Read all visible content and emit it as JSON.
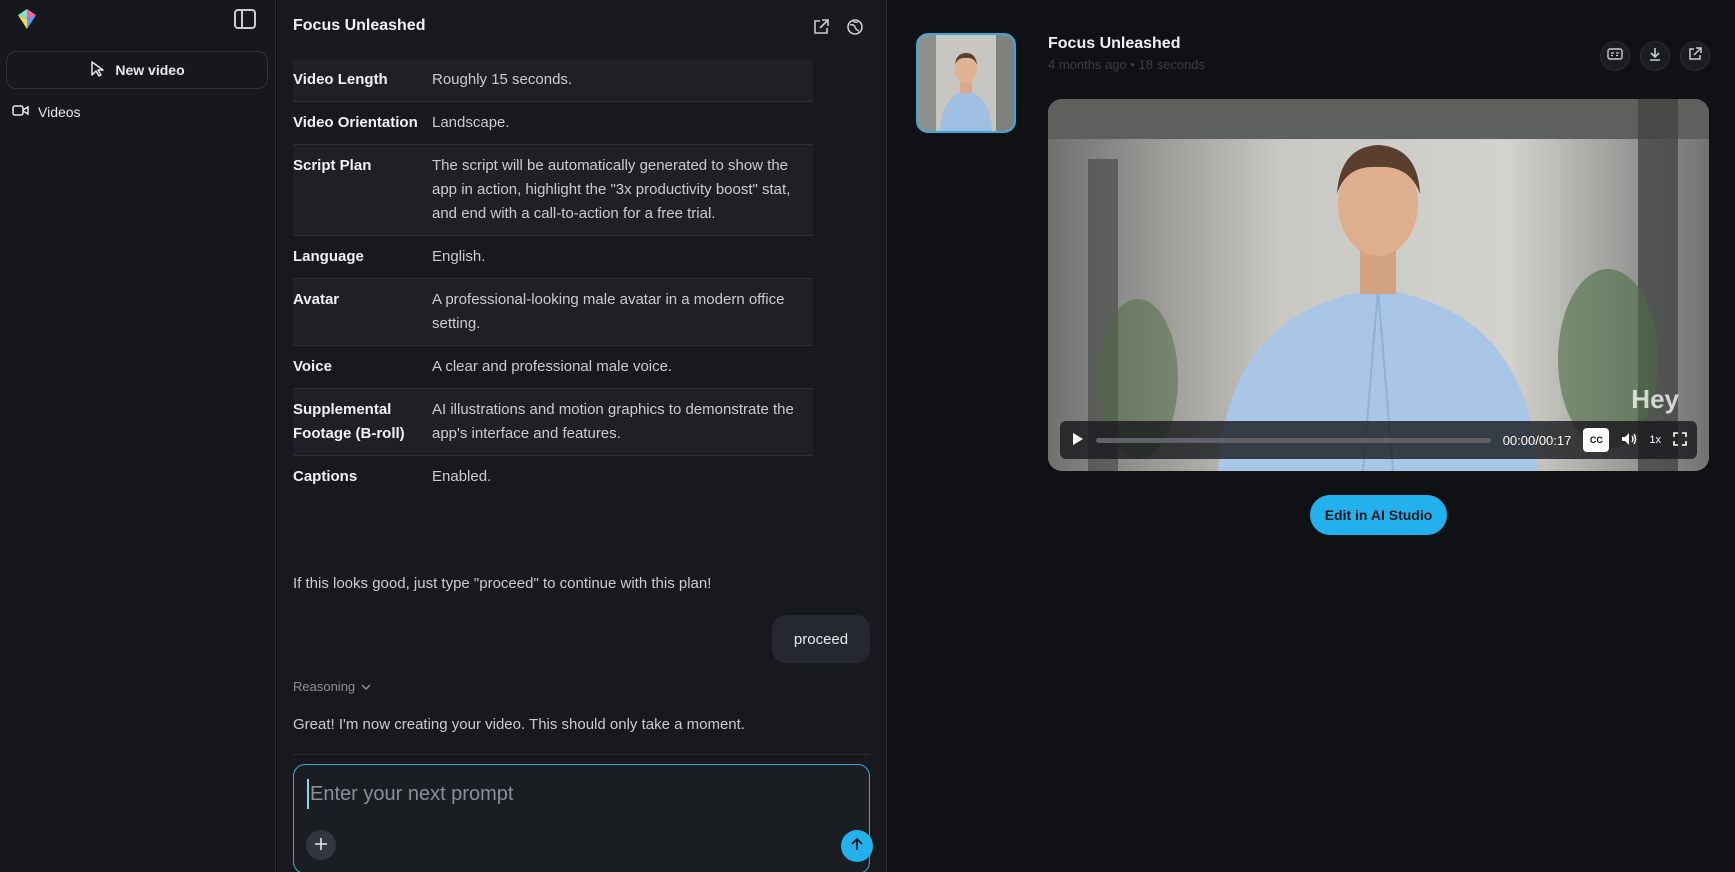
{
  "sidebar": {
    "new_video_label": "New video",
    "nav_items": [
      {
        "label": "Videos",
        "icon": "video-camera-icon"
      }
    ]
  },
  "chat": {
    "title": "Focus Unleashed",
    "plan_rows": [
      {
        "key": "Video Length",
        "value": "Roughly 15 seconds."
      },
      {
        "key": "Video Orientation",
        "value": "Landscape."
      },
      {
        "key": "Script Plan",
        "value": "The script will be automatically generated to show the app in action, highlight the \"3x productivity boost\" stat, and end with a call-to-action for a free trial."
      },
      {
        "key": "Language",
        "value": "English."
      },
      {
        "key": "Avatar",
        "value": "A professional-looking male avatar in a modern office setting."
      },
      {
        "key": "Voice",
        "value": "A clear and professional male voice."
      },
      {
        "key": "Supplemental Footage (B-roll)",
        "value": "AI illustrations and motion graphics to demonstrate the app's interface and features."
      },
      {
        "key": "Captions",
        "value": "Enabled."
      }
    ],
    "confirm_text": "If this looks good, just type \"proceed\" to continue with this plan!",
    "user_message": "proceed",
    "reasoning_label": "Reasoning",
    "ai_message": "Great! I'm now creating your video. This should only take a moment.",
    "prompt_placeholder": "Enter your next prompt"
  },
  "preview": {
    "title": "Focus Unleashed",
    "meta": "4 months ago • 18 seconds",
    "time": "00:00/00:17",
    "speed": "1x",
    "cc_label": "CC",
    "watermark": "Hey",
    "edit_button": "Edit in AI Studio"
  },
  "colors": {
    "accent": "#22b1ec",
    "background": "#0f1115",
    "panel": "#17191d"
  }
}
